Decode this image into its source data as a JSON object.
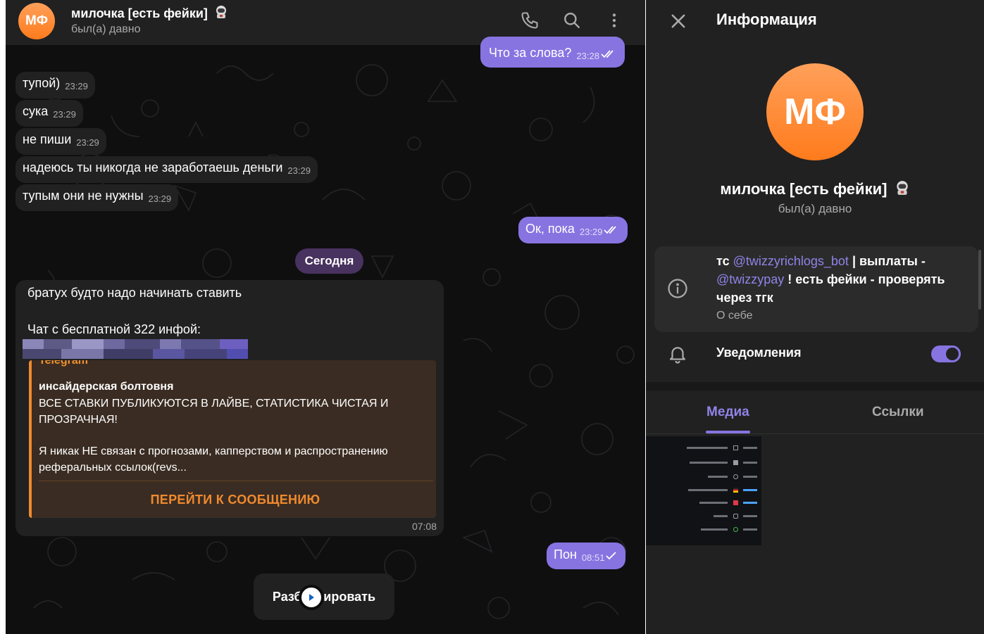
{
  "chat": {
    "header": {
      "avatar_initials": "МФ",
      "name": "милочка [есть фейки]",
      "name_emoji": "astronaut-icon",
      "status": "был(а) давно",
      "icons": [
        "phone-icon",
        "search-icon",
        "more-vertical-icon"
      ]
    },
    "messages": {
      "m0": {
        "text": "Что за слова?",
        "time": "23:28"
      },
      "m1": {
        "text": "тупой)",
        "time": "23:29"
      },
      "m2": {
        "text": "сука",
        "time": "23:29"
      },
      "m3": {
        "text": "не пиши",
        "time": "23:29"
      },
      "m4": {
        "text": "надеюсь ты никогда не заработаешь деньги",
        "time": "23:29"
      },
      "m5": {
        "text": "тупым они не нужны",
        "time": "23:29"
      },
      "m6": {
        "text": "Ок, пока",
        "time": "23:29"
      },
      "m8": {
        "text": "Пон",
        "time": "08:51"
      }
    },
    "date_divider": "Сегодня",
    "forwarded": {
      "line1": "братух будто надо начинать ставить",
      "line2": "Чат с бесплатной 322 инфой:",
      "preview": {
        "site": "Telegram",
        "title": "инсайдерская болтовня",
        "description": "ВСЕ СТАВКИ ПУБЛИКУЮТСЯ В ЛАЙВЕ, СТАТИСТИКА ЧИСТАЯ И ПРОЗРАЧНАЯ!",
        "description2": "Я никак НЕ связан с прогнозами, каппер­ством и распространению реферальных ссылок(revs...",
        "button": "ПЕРЕЙТИ К СООБЩЕНИЮ"
      },
      "time": "07:08"
    },
    "unblock_label": "Разблокировать"
  },
  "info": {
    "title": "Информация",
    "avatar_initials": "МФ",
    "name": "милочка [есть фейки]",
    "status": "был(а) давно",
    "bio": {
      "p1": "тс ",
      "link1": "@twizzyrichlogs_bot",
      "p2": " | выплаты - ",
      "link2": "@twizzypay",
      "p3": " ! есть фейки - проверять через тгк",
      "label": "О себе"
    },
    "notifications": {
      "label": "Уведомления",
      "enabled": true
    },
    "tabs": [
      "Медиа",
      "Ссылки"
    ],
    "active_tab": "Медиа"
  },
  "colors": {
    "accent": "#8774e1",
    "avatar_orange": "#ff8a2b",
    "panel": "#212121",
    "chat_bg": "#0f0f10",
    "preview_accent": "#f08a2e"
  }
}
